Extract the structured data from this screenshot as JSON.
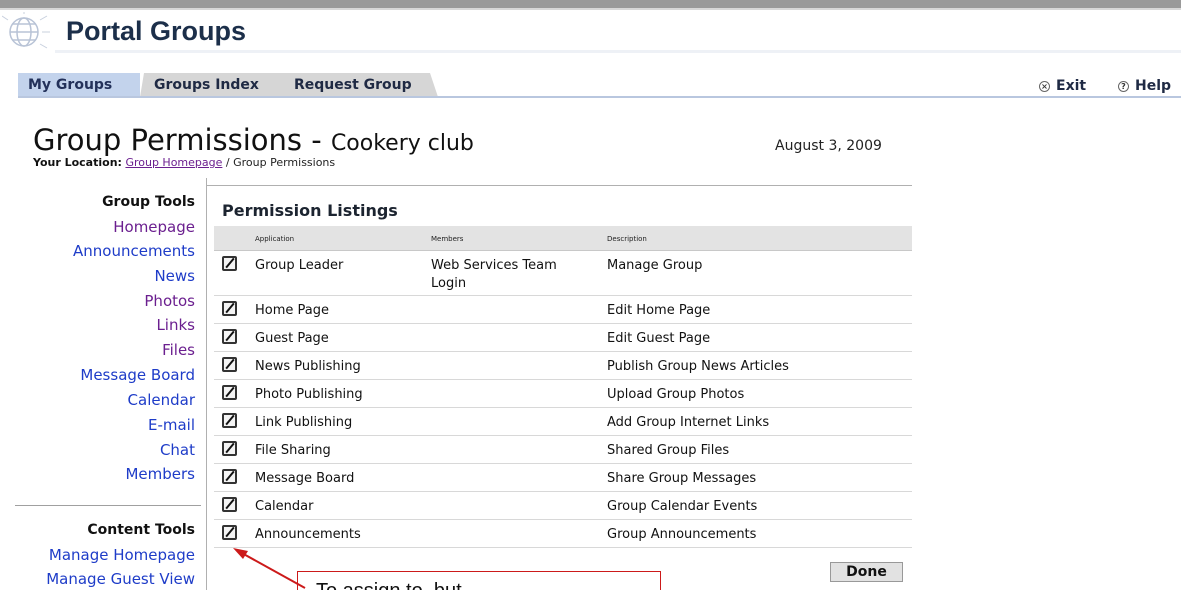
{
  "app": {
    "title": "Portal Groups"
  },
  "tabs": [
    {
      "label": "My Groups",
      "active": true
    },
    {
      "label": "Groups Index",
      "active": false
    },
    {
      "label": "Request Group",
      "active": false
    }
  ],
  "util_links": {
    "exit": "Exit",
    "help": "Help"
  },
  "page": {
    "title_main": "Group Permissions",
    "title_sep": " - ",
    "group_name": "Cookery club",
    "date": "August 3, 2009",
    "location_label": "Your Location:",
    "breadcrumb_link": "Group Homepage",
    "breadcrumb_sep": " / ",
    "breadcrumb_current": "Group Permissions"
  },
  "sidebar": {
    "group_tools": {
      "heading": "Group Tools",
      "items": [
        "Homepage",
        "Announcements",
        "News",
        "Photos",
        "Links",
        "Files",
        "Message Board",
        "Calendar",
        "E-mail",
        "Chat",
        "Members"
      ]
    },
    "content_tools": {
      "heading": "Content Tools",
      "items": [
        "Manage Homepage",
        "Manage Guest View"
      ]
    }
  },
  "permissions": {
    "heading": "Permission Listings",
    "columns": [
      "Application",
      "Members",
      "Description"
    ],
    "rows": [
      {
        "application": "Group Leader",
        "members": [
          "Web Services Team",
          "Login"
        ],
        "description": "Manage Group"
      },
      {
        "application": "Home Page",
        "members": [],
        "description": "Edit Home Page"
      },
      {
        "application": "Guest Page",
        "members": [],
        "description": "Edit Guest Page"
      },
      {
        "application": "News Publishing",
        "members": [],
        "description": "Publish Group News Articles"
      },
      {
        "application": "Photo Publishing",
        "members": [],
        "description": "Upload Group Photos"
      },
      {
        "application": "Link Publishing",
        "members": [],
        "description": "Add Group Internet Links"
      },
      {
        "application": "File Sharing",
        "members": [],
        "description": "Shared Group Files"
      },
      {
        "application": "Message Board",
        "members": [],
        "description": "Share Group Messages"
      },
      {
        "application": "Calendar",
        "members": [],
        "description": "Group Calendar Events"
      },
      {
        "application": "Announcements",
        "members": [],
        "description": "Group Announcements"
      }
    ],
    "done_label": "Done"
  },
  "callout": {
    "text": "To assign to, but..."
  },
  "colors": {
    "link_blue": "#1e3cc8",
    "link_visited": "#6b1f8f",
    "callout_red": "#cc1a1a",
    "tab_active": "#c3d3ec"
  },
  "icons": {
    "row_edit": "edit-pencil-icon",
    "exit": "close-icon",
    "help": "help-icon",
    "logo": "globe-logo-icon"
  }
}
